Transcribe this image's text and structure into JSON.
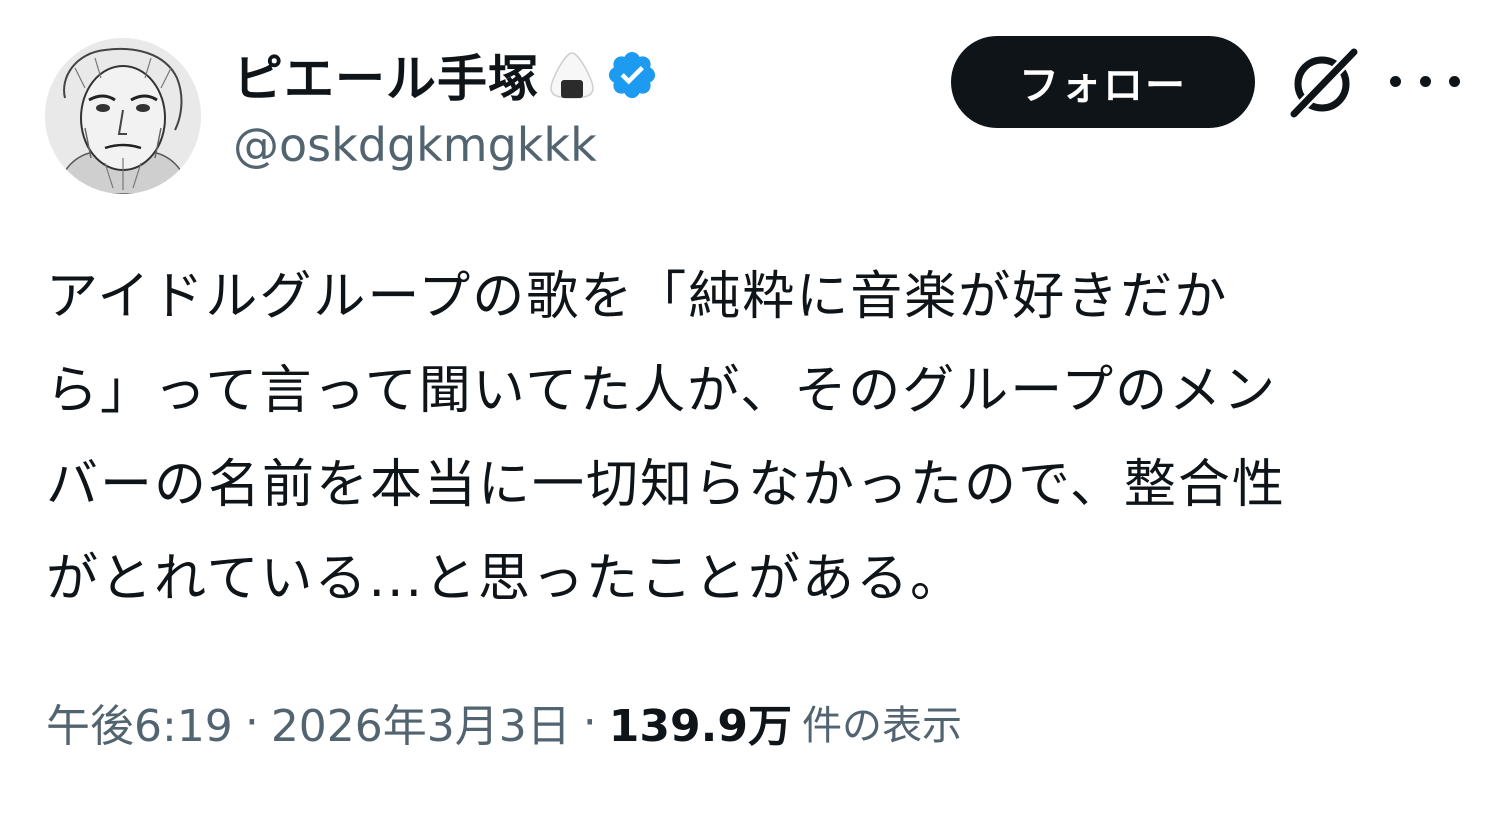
{
  "author": {
    "display_name": "ピエール手塚",
    "handle": "@oskdgkmgkkk",
    "emoji_icon": "rice-ball-icon",
    "verified_icon": "verified-badge-icon",
    "verified_color": "#1d9bf0"
  },
  "actions": {
    "follow_label": "フォロー",
    "grok_icon": "grok-icon",
    "more_icon": "more-icon"
  },
  "tweet": {
    "lines": [
      "アイドルグループの歌を「純粋に音楽が好きだか",
      "ら」って言って聞いてた人が、そのグループのメン",
      "バーの名前を本当に一切知らなかったので、整合性",
      "がとれている...と思ったことがある。"
    ]
  },
  "meta": {
    "time": "午後6:19",
    "separator": "·",
    "date": "2026年3月3日",
    "views_count": "139.9万",
    "views_label": "件の表示"
  },
  "colors": {
    "text": "#0f1419",
    "secondary": "#536471",
    "follow_bg": "#0f1419"
  }
}
